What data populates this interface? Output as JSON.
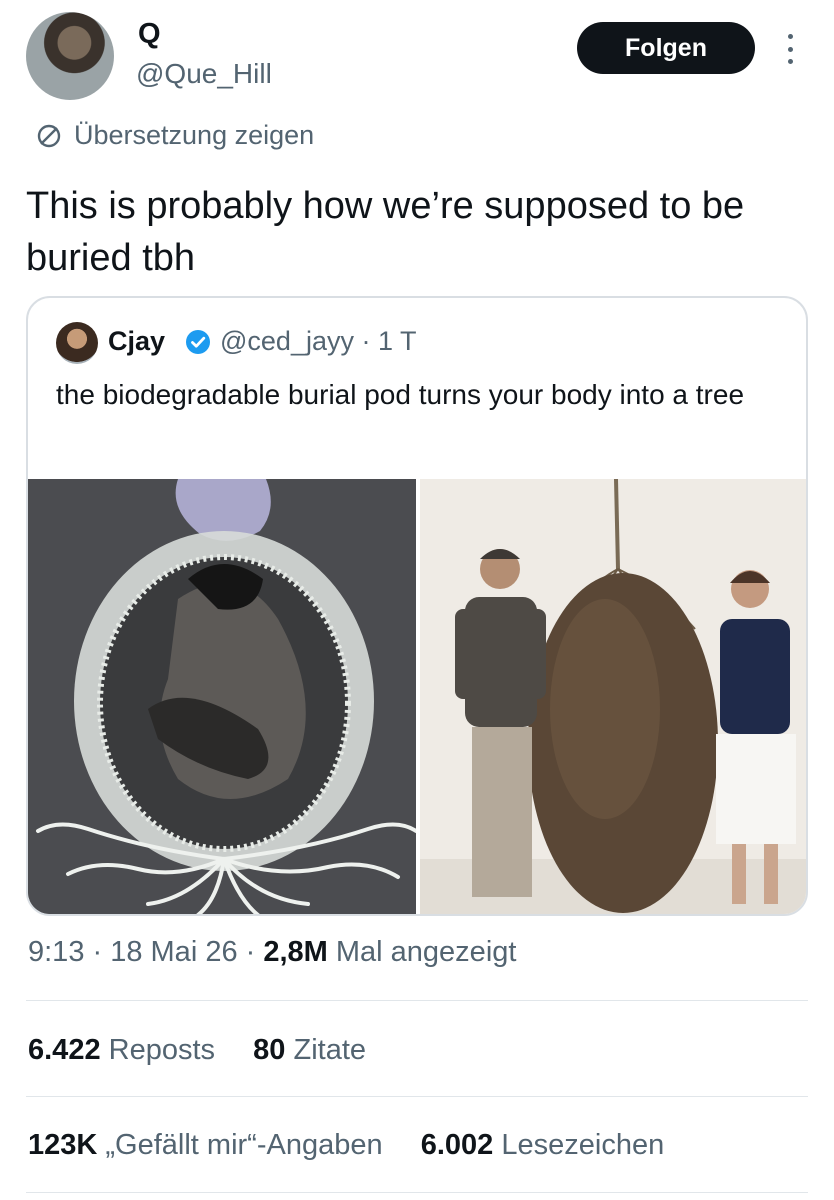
{
  "author": {
    "display_name": "Q",
    "handle": "@Que_Hill"
  },
  "follow_label": "Folgen",
  "translate_label": "Übersetzung zeigen",
  "tweet_text": "This is probably how we’re supposed to be buried tbh",
  "quote": {
    "name": "Cjay",
    "handle_time": "@ced_jayy · 1 T",
    "text": "the biodegradable burial pod turns your body into a tree"
  },
  "meta": {
    "time_date": "9:13 · 18 Mai 26 · ",
    "views_count": "2,8M",
    "views_label": " Mal angezeigt"
  },
  "stats": {
    "reposts_count": "6.422",
    "reposts_label": " Reposts",
    "quotes_count": "80",
    "quotes_label": " Zitate",
    "likes_count": "123K",
    "likes_label": " „Gefällt mir“-Angaben",
    "bookmarks_count": "6.002",
    "bookmarks_label": " Lesezeichen"
  },
  "colors": {
    "text_primary": "#0f1419",
    "text_secondary": "#536471",
    "verified_blue": "#1d9bf0",
    "button_bg": "#0f1419"
  },
  "icons": [
    "translate-icon",
    "verified-badge-icon",
    "more-options-icon"
  ]
}
